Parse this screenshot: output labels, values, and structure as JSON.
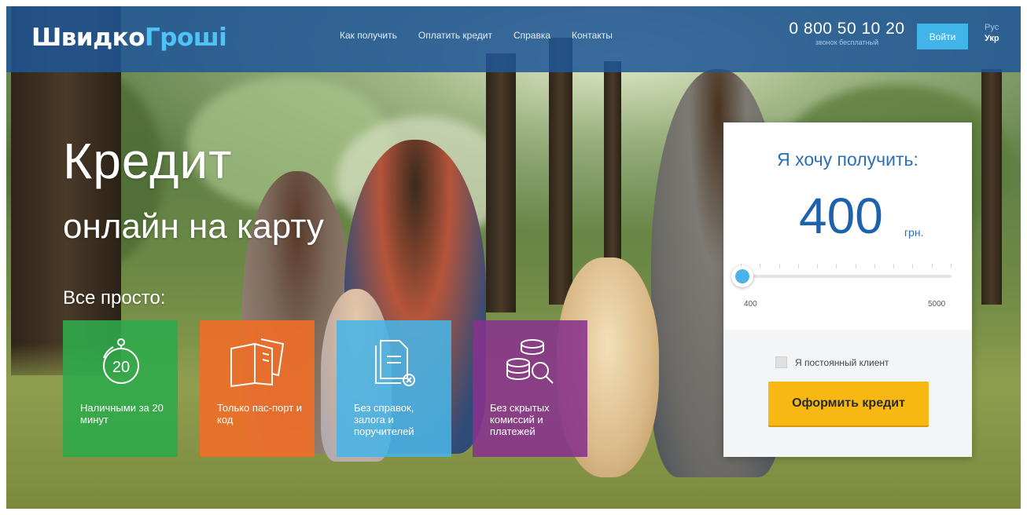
{
  "header": {
    "logo_part1": "Швидко",
    "logo_part2": "Гроші",
    "nav": [
      "Как получить",
      "Оплатить кредит",
      "Справка",
      "Контакты"
    ],
    "phone": "0 800 50 10 20",
    "phone_note": "звонок бесплатный",
    "login_label": "Войти",
    "lang_ru": "Рус",
    "lang_uk": "Укр"
  },
  "hero": {
    "title": "Кредит",
    "subtitle": "онлайн на карту",
    "simple": "Все просто:"
  },
  "features": [
    {
      "icon": "stopwatch-icon",
      "number": "20",
      "text": "Наличными за 20 минут",
      "color": "#2faa4a"
    },
    {
      "icon": "passport-icon",
      "text": "Только пас-порт и код",
      "color": "#f06e28"
    },
    {
      "icon": "document-icon",
      "text": "Без справок, залога и поручителей",
      "color": "#48b4e6"
    },
    {
      "icon": "coins-search-icon",
      "text": "Без скрытых комиссий и платежей",
      "color": "#87328c"
    }
  ],
  "calculator": {
    "heading": "Я хочу получить:",
    "amount": "400",
    "currency": "грн.",
    "min": "400",
    "max": "5000",
    "slider_fraction": 0,
    "regular_client_label": "Я постоянный клиент",
    "regular_client_checked": false,
    "apply_label": "Оформить кредит"
  },
  "colors": {
    "header_bg": "#205696",
    "accent_blue": "#41b4ea",
    "button_yellow": "#f7b813",
    "amount_blue": "#1e62ae"
  }
}
